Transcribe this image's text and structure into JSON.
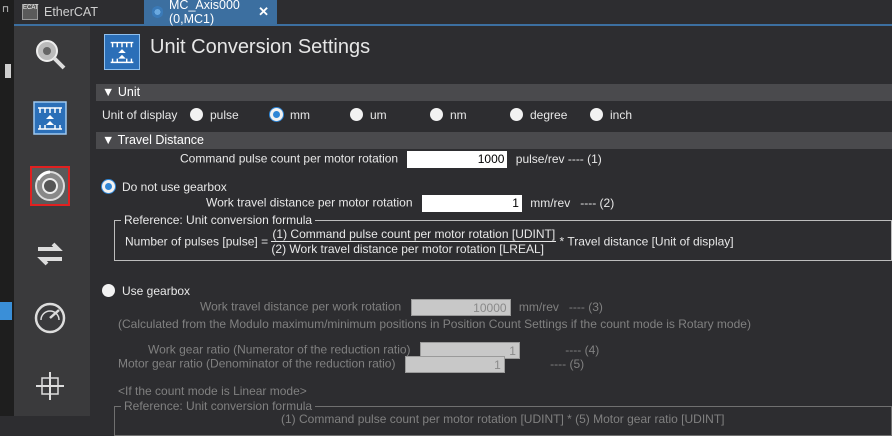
{
  "tabs": [
    {
      "label": "EtherCAT",
      "icon": "ethercat-icon"
    },
    {
      "label": "MC_Axis000 (0,MC1)",
      "icon": "axis-gear-icon",
      "close": "✕"
    }
  ],
  "page_title": "Unit Conversion Settings",
  "unit_section": {
    "header": "▼ Unit",
    "label": "Unit of display",
    "options": [
      "pulse",
      "mm",
      "um",
      "nm",
      "degree",
      "inch"
    ],
    "selected": "mm"
  },
  "travel_section": {
    "header": "▼ Travel Distance",
    "command_pulse_label": "Command pulse count per motor rotation",
    "command_pulse_value": "1000",
    "command_pulse_unit": "pulse/rev ---- (1)",
    "no_gearbox_label": "Do not use gearbox",
    "work_travel_label": "Work travel distance per motor rotation",
    "work_travel_value": "1",
    "work_travel_unit": "mm/rev   ---- (2)",
    "ref_title": "Reference: Unit conversion formula",
    "formula_lhs": "Number of pulses [pulse] =",
    "formula_num": "(1) Command pulse count per motor rotation [UDINT]",
    "formula_den": "(2) Work travel distance per motor rotation [LREAL]",
    "formula_rhs": "* Travel distance [Unit of display]",
    "use_gearbox_label": "Use gearbox",
    "work_rot_label": "Work travel distance per work rotation",
    "work_rot_value": "10000",
    "work_rot_unit": "mm/rev   ---- (3)",
    "modulo_note": "(Calculated from the Modulo maximum/minimum positions in Position Count Settings if the count mode is Rotary mode)",
    "work_gear_label": "Work gear ratio (Numerator of the reduction ratio)",
    "work_gear_value": "1",
    "work_gear_suffix": "---- (4)",
    "motor_gear_label": "Motor gear ratio (Denominator of the reduction ratio)",
    "motor_gear_value": "1",
    "motor_gear_suffix": "---- (5)",
    "linear_note": "<If the count mode is Linear mode>",
    "ref_title2": "Reference: Unit conversion formula",
    "formula2_partial": "(1) Command pulse count per motor rotation [UDINT] * (5) Motor gear ratio [UDINT]"
  },
  "colors": {
    "accent": "#3c6fa0",
    "selected_tool_border": "#e02020",
    "radio_on": "#2f86d6"
  }
}
